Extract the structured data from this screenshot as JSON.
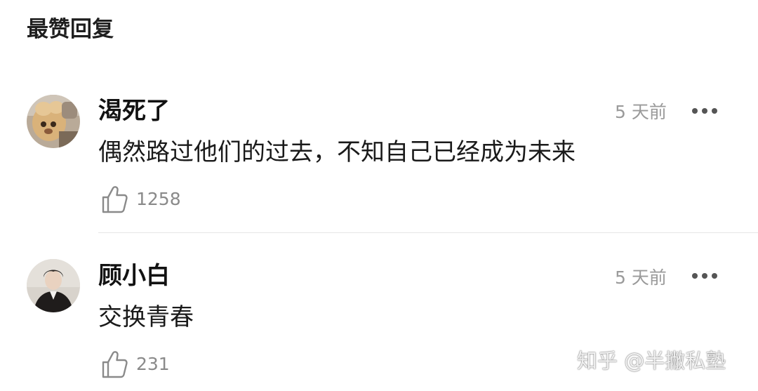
{
  "section": {
    "title": "最赞回复"
  },
  "comments": [
    {
      "username": "渴死了",
      "timestamp": "5 天前",
      "content": "偶然路过他们的过去，不知自己已经成为未来",
      "likes": "1258",
      "avatar_icon": "avatar-plush-toy"
    },
    {
      "username": "顾小白",
      "timestamp": "5 天前",
      "content": "交换青春",
      "likes": "231",
      "avatar_icon": "avatar-person-dark-coat"
    }
  ],
  "icons": {
    "more": "more-dots-icon",
    "like": "thumbs-up-icon"
  },
  "watermark": {
    "text": "知乎 @半撇私塾"
  },
  "colors": {
    "background": "#ffffff",
    "text_primary": "#1a1a1a",
    "text_secondary": "#9a9a9a",
    "divider": "#e6e6e6"
  }
}
